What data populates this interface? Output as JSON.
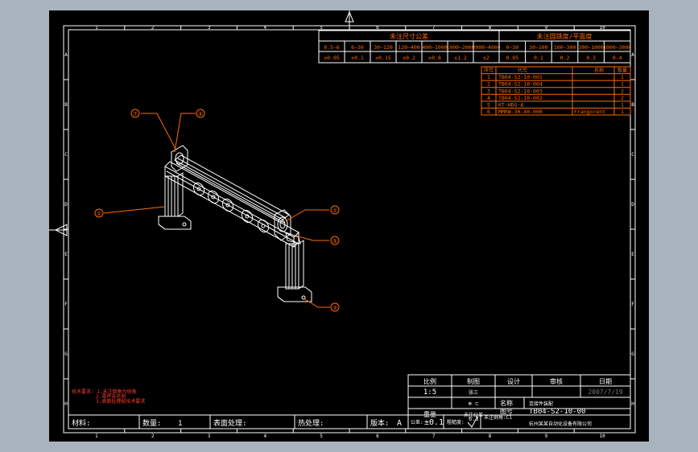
{
  "border": {
    "col_markers": [
      "1",
      "2",
      "3",
      "4",
      "5",
      "6",
      "7",
      "8",
      "9",
      "10"
    ],
    "row_markers": [
      "A",
      "B",
      "C",
      "D",
      "E",
      "F",
      "G",
      "H"
    ]
  },
  "tolerance_table": {
    "title_linear": "未注尺寸公差",
    "title_angular": "未注圆跳度/平面度",
    "linear_ranges": [
      "0.5~6",
      "6~30",
      "30~120",
      "120~400",
      "400~1000",
      "1000~2000",
      "2000~4000"
    ],
    "linear_values": [
      "±0.05",
      "±0.1",
      "±0.15",
      "±0.2",
      "±0.8",
      "±1.2",
      "±2"
    ],
    "flat_ranges": [
      "0~30",
      "30~100",
      "100~300",
      "300~1000",
      "1000~3000"
    ],
    "flat_values": [
      "0.05",
      "0.1",
      "0.2",
      "0.3",
      "0.4"
    ]
  },
  "bom": {
    "headers": [
      "序号",
      "代号",
      "名称",
      "数量"
    ],
    "rows": [
      {
        "no": "1",
        "code": "TB04-S2-10-001",
        "name": "",
        "qty": "1"
      },
      {
        "no": "2",
        "code": "TB04-S2-10-004",
        "name": "",
        "qty": "1"
      },
      {
        "no": "3",
        "code": "TB04-S2-10-003",
        "name": "",
        "qty": "2"
      },
      {
        "no": "4",
        "code": "TB04-S2-10-002",
        "name": "",
        "qty": "2"
      },
      {
        "no": "5",
        "code": "KT-HDG-A",
        "name": "",
        "qty": "1"
      },
      {
        "no": "6",
        "code": "MMRW-30-40-000",
        "name": "Frangorent",
        "qty": "1"
      }
    ]
  },
  "callouts": [
    "①",
    "②",
    "③",
    "④",
    "⑤",
    "⑦"
  ],
  "notes": {
    "heading": "技术要求: 1.未注倒角为锐角",
    "line1": "2.零件去毛刺",
    "line2": "3.表面处理按技术要求"
  },
  "title_block": {
    "headers": [
      "比例",
      "制图",
      "设计",
      "审核",
      "日期"
    ],
    "scale_value": "1:5",
    "drafter": "张三",
    "date_value": "2007/7/19",
    "projection_symbol": "⊕ ⊂",
    "name_label": "名称",
    "name_value": "连接件装配",
    "material_label": "重量",
    "material_value": "未注公差",
    "drawing_no_label": "图号",
    "drawing_no_value": "TB04-S2-10-00",
    "bottom_labels": [
      "材料:",
      "数量:",
      "表面处理:",
      "热处理:",
      "版本:"
    ],
    "qty_value": "1",
    "version_value": "A",
    "tolerance_label": "公差:",
    "tolerance_value": "±0.1",
    "roughness_label": "粗糙度:",
    "roughness_value": "6.3",
    "note_label": "未注倒角:C1",
    "company": "杭州某某自动化设备有限公司"
  },
  "colors": {
    "sheet": "#000000",
    "background": "#a9b3bd",
    "lines": "#ffffff",
    "accent": "#ff6a00",
    "note": "#ff3b30"
  }
}
